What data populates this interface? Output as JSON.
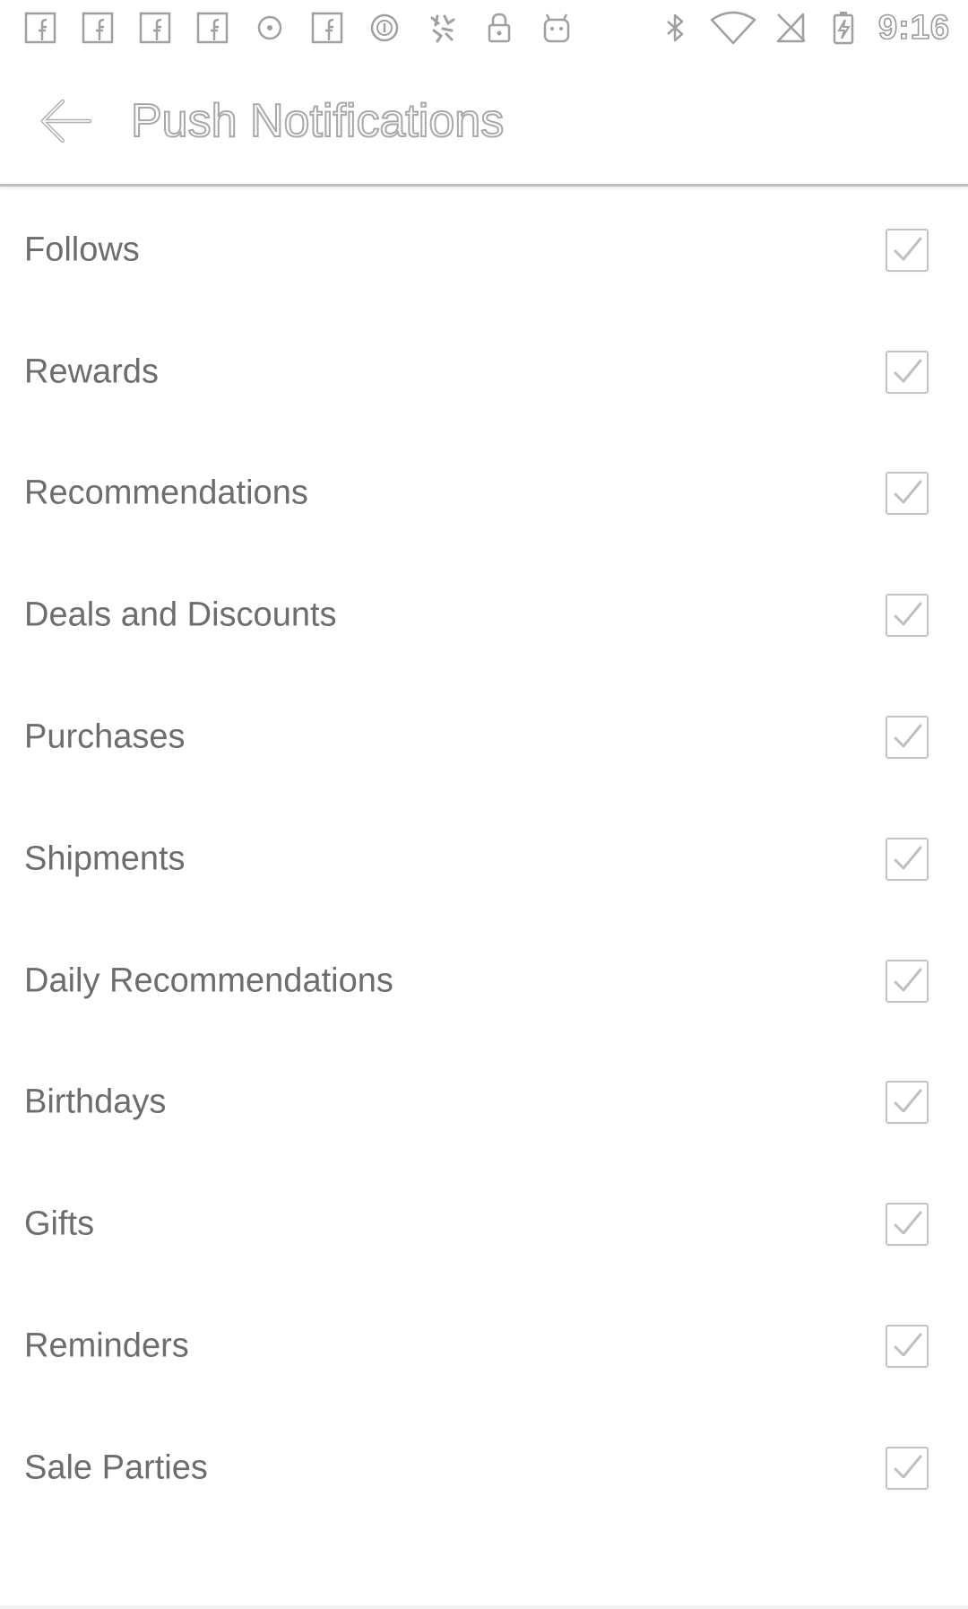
{
  "status_bar": {
    "left_icons": [
      "facebook-icon",
      "facebook-icon",
      "facebook-icon",
      "facebook-icon",
      "circle-dot-icon",
      "facebook-icon",
      "circle-notification-icon",
      "flowers-icon",
      "lock-icon",
      "android-icon"
    ],
    "right_icons": [
      "bluetooth-icon",
      "wifi-icon",
      "no-sim-icon",
      "battery-charging-icon"
    ],
    "time": "9:16"
  },
  "app_bar": {
    "title": "Push Notifications",
    "back_icon": "arrow-back-icon"
  },
  "settings": [
    {
      "label": "Follows",
      "checked": true
    },
    {
      "label": "Rewards",
      "checked": true
    },
    {
      "label": "Recommendations",
      "checked": true
    },
    {
      "label": "Deals and Discounts",
      "checked": true
    },
    {
      "label": "Purchases",
      "checked": true
    },
    {
      "label": "Shipments",
      "checked": true
    },
    {
      "label": "Daily Recommendations",
      "checked": true
    },
    {
      "label": "Birthdays",
      "checked": true
    },
    {
      "label": "Gifts",
      "checked": true
    },
    {
      "label": "Reminders",
      "checked": true
    },
    {
      "label": "Sale Parties",
      "checked": true
    }
  ],
  "colors": {
    "label_text": "#6d6d6d",
    "checkbox_border": "#c4c4c4",
    "checkmark": "#bfbfbf",
    "divider": "#bdbdbd",
    "background": "#ffffff"
  }
}
